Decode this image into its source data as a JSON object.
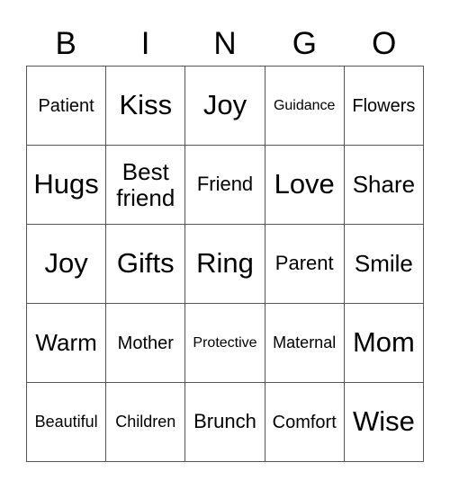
{
  "header": [
    "B",
    "I",
    "N",
    "G",
    "O"
  ],
  "cells": [
    [
      "Patient",
      "Kiss",
      "Joy",
      "Guidance",
      "Flowers"
    ],
    [
      "Hugs",
      "Best friend",
      "Friend",
      "Love",
      "Share"
    ],
    [
      "Joy",
      "Gifts",
      "Ring",
      "Parent",
      "Smile"
    ],
    [
      "Warm",
      "Mother",
      "Protective",
      "Maternal",
      "Mom"
    ],
    [
      "Beautiful",
      "Children",
      "Brunch",
      "Comfort",
      "Wise"
    ]
  ]
}
